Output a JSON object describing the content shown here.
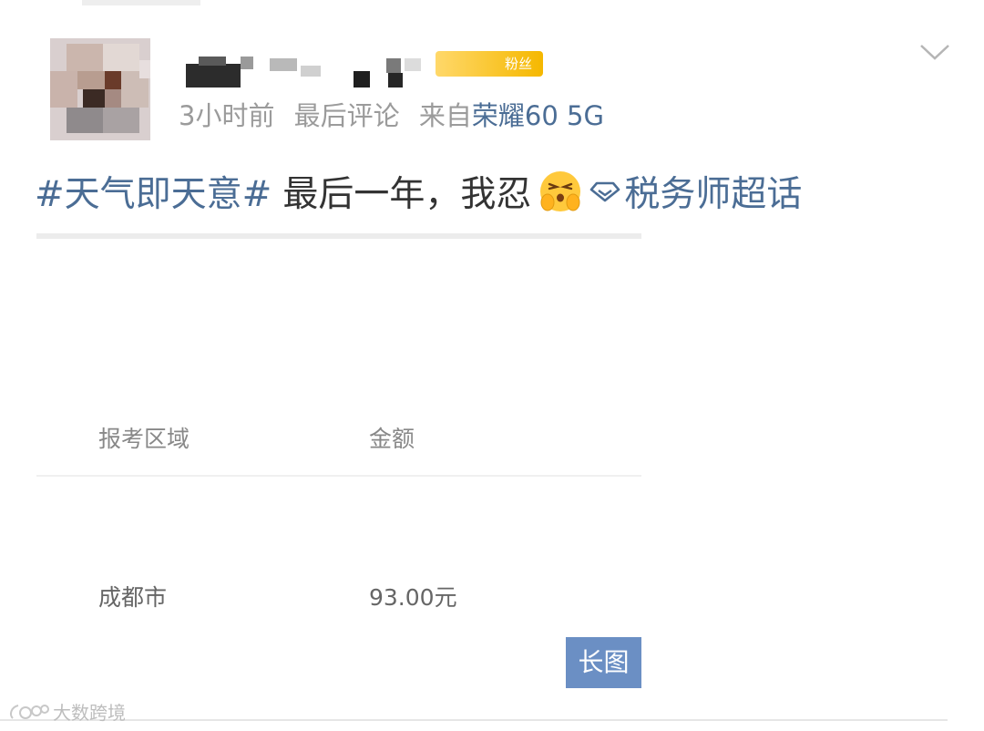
{
  "post": {
    "user": {
      "avatar_icon": "blurred-avatar",
      "fans_badge": "粉丝"
    },
    "meta": {
      "time": "3小时前",
      "sort": "最后评论",
      "from_prefix": "来自",
      "device": "荣耀60 5G"
    },
    "content": {
      "hashtag": "#天气即天意#",
      "text": "最后一年，我忍",
      "emoji_icon": "holding-back-emoji",
      "supertopic_icon": "diamond-icon",
      "supertopic": "税务师超话"
    },
    "image": {
      "headers": [
        "报考区域",
        "金额"
      ],
      "rows": [
        {
          "region": "成都市",
          "amount": "93.00元"
        }
      ],
      "long_image_label": "长图"
    }
  },
  "watermark": {
    "text": "大数跨境"
  },
  "colors": {
    "link": "#4b6d95",
    "meta": "#9b9b9b",
    "badge": "#f5b800",
    "long_image_badge": "#6b8fc4"
  }
}
